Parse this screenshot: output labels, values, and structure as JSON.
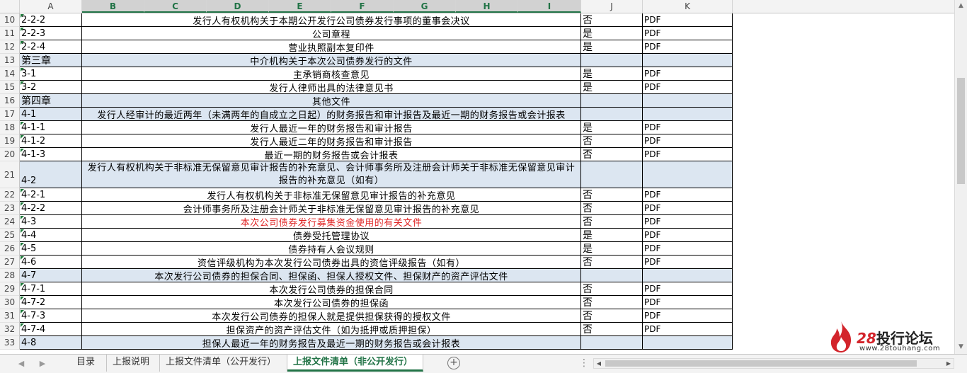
{
  "columns": [
    "A",
    "B",
    "C",
    "D",
    "E",
    "F",
    "G",
    "H",
    "I",
    "J",
    "K"
  ],
  "rows": [
    {
      "rn": "10",
      "a": "2-2-2",
      "m": "发行人有权机构关于本期公开发行公司债券发行事项的董事会决议",
      "j": "否",
      "k": "PDF",
      "type": "item"
    },
    {
      "rn": "11",
      "a": "2-2-3",
      "m": "公司章程",
      "j": "是",
      "k": "PDF",
      "type": "item"
    },
    {
      "rn": "12",
      "a": "2-2-4",
      "m": "营业执照副本复印件",
      "j": "是",
      "k": "PDF",
      "type": "item"
    },
    {
      "rn": "13",
      "a": "第三章",
      "m": "中介机构关于本次公司债券发行的文件",
      "j": "",
      "k": "",
      "type": "chap"
    },
    {
      "rn": "14",
      "a": "3-1",
      "m": "主承销商核查意见",
      "j": "是",
      "k": "PDF",
      "type": "item"
    },
    {
      "rn": "15",
      "a": "3-2",
      "m": "发行人律师出具的法律意见书",
      "j": "是",
      "k": "PDF",
      "type": "item"
    },
    {
      "rn": "16",
      "a": "第四章",
      "m": "其他文件",
      "j": "",
      "k": "",
      "type": "chap"
    },
    {
      "rn": "17",
      "a": "4-1",
      "m": "发行人经审计的最近两年（未满两年的自成立之日起）的财务报告和审计报告及最近一期的财务报告或会计报表",
      "j": "",
      "k": "",
      "type": "sect"
    },
    {
      "rn": "18",
      "a": "4-1-1",
      "m": "发行人最近一年的财务报告和审计报告",
      "j": "是",
      "k": "PDF",
      "type": "item"
    },
    {
      "rn": "19",
      "a": "4-1-2",
      "m": "发行人最近二年的财务报告和审计报告",
      "j": "否",
      "k": "PDF",
      "type": "item"
    },
    {
      "rn": "20",
      "a": "4-1-3",
      "m": "最近一期的财务报告或会计报表",
      "j": "否",
      "k": "PDF",
      "type": "item"
    },
    {
      "rn": "21",
      "a": "4-2",
      "m": "发行人有权机构关于非标准无保留意见审计报告的补充意见、会计师事务所及注册会计师关于非标准无保留意见审计报告的补充意见（如有）",
      "j": "",
      "k": "",
      "type": "sect-tall"
    },
    {
      "rn": "22",
      "a": "4-2-1",
      "m": "发行人有权机构关于非标准无保留意见审计报告的补充意见",
      "j": "否",
      "k": "PDF",
      "type": "item"
    },
    {
      "rn": "23",
      "a": "4-2-2",
      "m": "会计师事务所及注册会计师关于非标准无保留意见审计报告的补充意见",
      "j": "否",
      "k": "PDF",
      "type": "item"
    },
    {
      "rn": "24",
      "a": "4-3",
      "m": "本次公司债券发行募集资金使用的有关文件",
      "j": "否",
      "k": "PDF",
      "type": "item-red"
    },
    {
      "rn": "25",
      "a": "4-4",
      "m": "债券受托管理协议",
      "j": "是",
      "k": "PDF",
      "type": "item"
    },
    {
      "rn": "26",
      "a": "4-5",
      "m": "债券持有人会议规则",
      "j": "是",
      "k": "PDF",
      "type": "item"
    },
    {
      "rn": "27",
      "a": "4-6",
      "m": "资信评级机构为本次发行公司债券出具的资信评级报告（如有）",
      "j": "否",
      "k": "PDF",
      "type": "item"
    },
    {
      "rn": "28",
      "a": "4-7",
      "m": "本次发行公司债券的担保合同、担保函、担保人授权文件、担保财产的资产评估文件",
      "j": "",
      "k": "",
      "type": "sect"
    },
    {
      "rn": "29",
      "a": "4-7-1",
      "m": "本次发行公司债券的担保合同",
      "j": "否",
      "k": "PDF",
      "type": "item"
    },
    {
      "rn": "30",
      "a": "4-7-2",
      "m": "本次发行公司债券的担保函",
      "j": "否",
      "k": "PDF",
      "type": "item"
    },
    {
      "rn": "31",
      "a": "4-7-3",
      "m": "本次发行公司债券的担保人就是提供担保获得的授权文件",
      "j": "否",
      "k": "PDF",
      "type": "item"
    },
    {
      "rn": "32",
      "a": "4-7-4",
      "m": "担保资产的资产评估文件（如为抵押或质押担保）",
      "j": "否",
      "k": "PDF",
      "type": "item"
    },
    {
      "rn": "33",
      "a": "4-8",
      "m": "担保人最近一年的财务报告及最近一期的财务报告或会计报表",
      "j": "",
      "k": "",
      "type": "sect"
    }
  ],
  "tabs": [
    "目录",
    "上报说明",
    "上报文件清单（公开发行）",
    "上报文件清单（非公开发行）"
  ],
  "active_tab": 3,
  "add_sheet_label": "+",
  "logo": {
    "num": "28",
    "title": "投行论坛",
    "url": "www.28touhang.com"
  },
  "colors": {
    "accent": "#217346",
    "chapter_fill": "#dce6f1",
    "red_text": "#e02424",
    "logo_red": "#d3242b"
  },
  "icons": {
    "tab_prev": "triangle-left-icon",
    "tab_next": "triangle-right-icon",
    "add": "plus-circle-icon"
  }
}
